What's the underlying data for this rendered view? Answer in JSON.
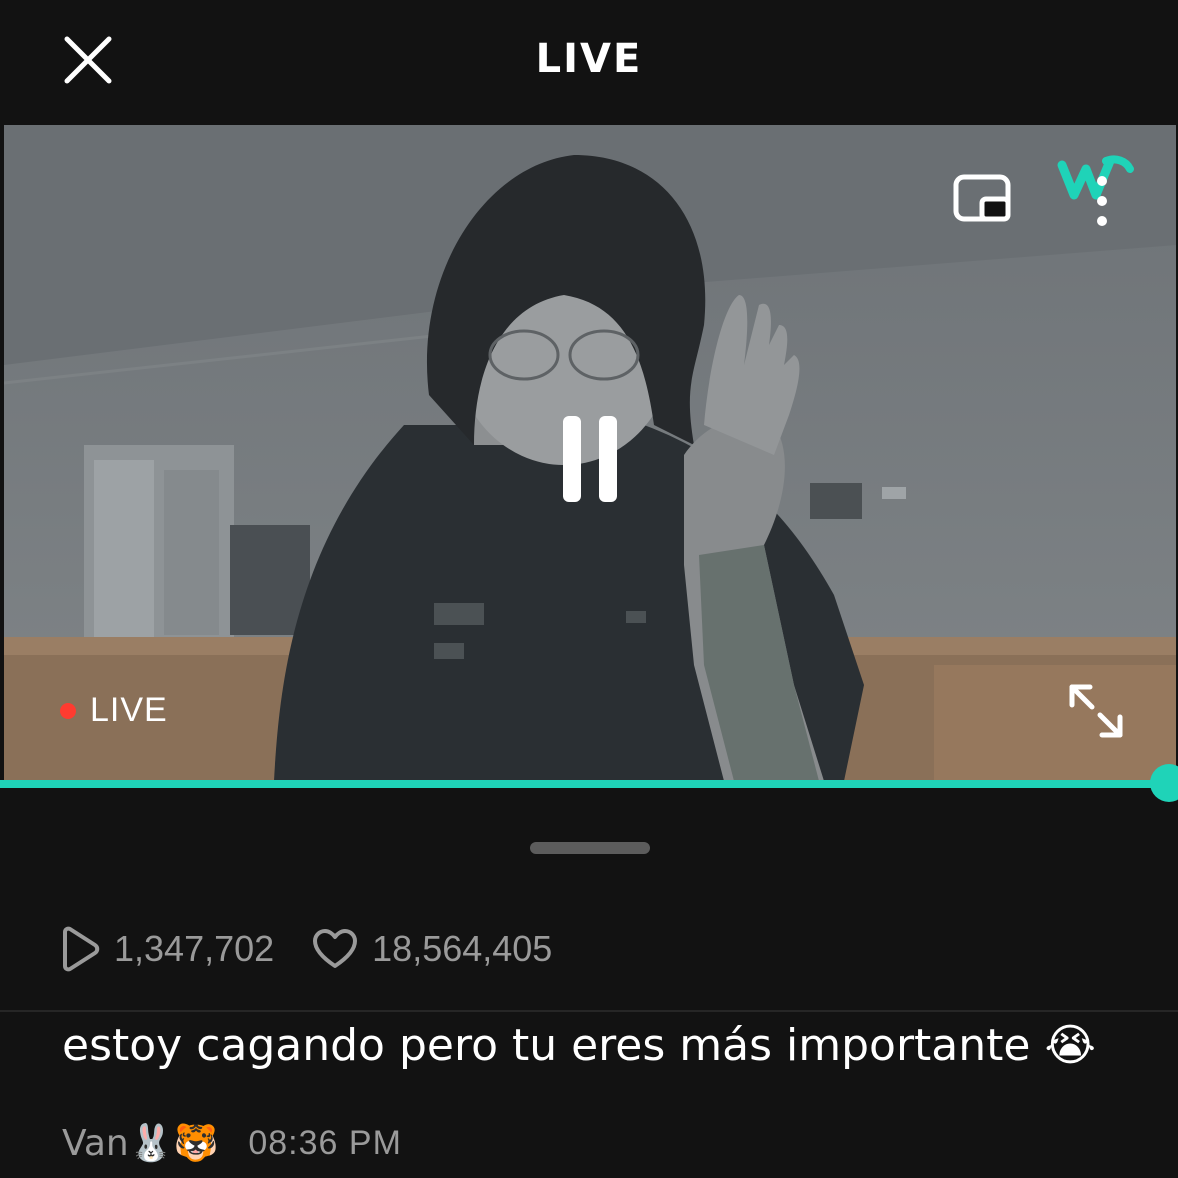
{
  "header": {
    "title": "LIVE",
    "close_icon": "close-icon"
  },
  "player": {
    "live_label": "LIVE",
    "live_dot_color": "#ff3b30",
    "pip_icon": "picture-in-picture-icon",
    "more_icon": "more-vertical-icon",
    "pause_icon": "pause-icon",
    "fullscreen_icon": "expand-icon",
    "progress": 1.0,
    "accent_color": "#1fd3b8"
  },
  "stats": {
    "views": "1,347,702",
    "likes": "18,564,405",
    "views_icon": "play-icon",
    "likes_icon": "heart-icon"
  },
  "comment": {
    "text": "estoy cagando pero tu eres más importante 😭",
    "author": "Van🐰🐯",
    "time": "08:36 PM"
  }
}
